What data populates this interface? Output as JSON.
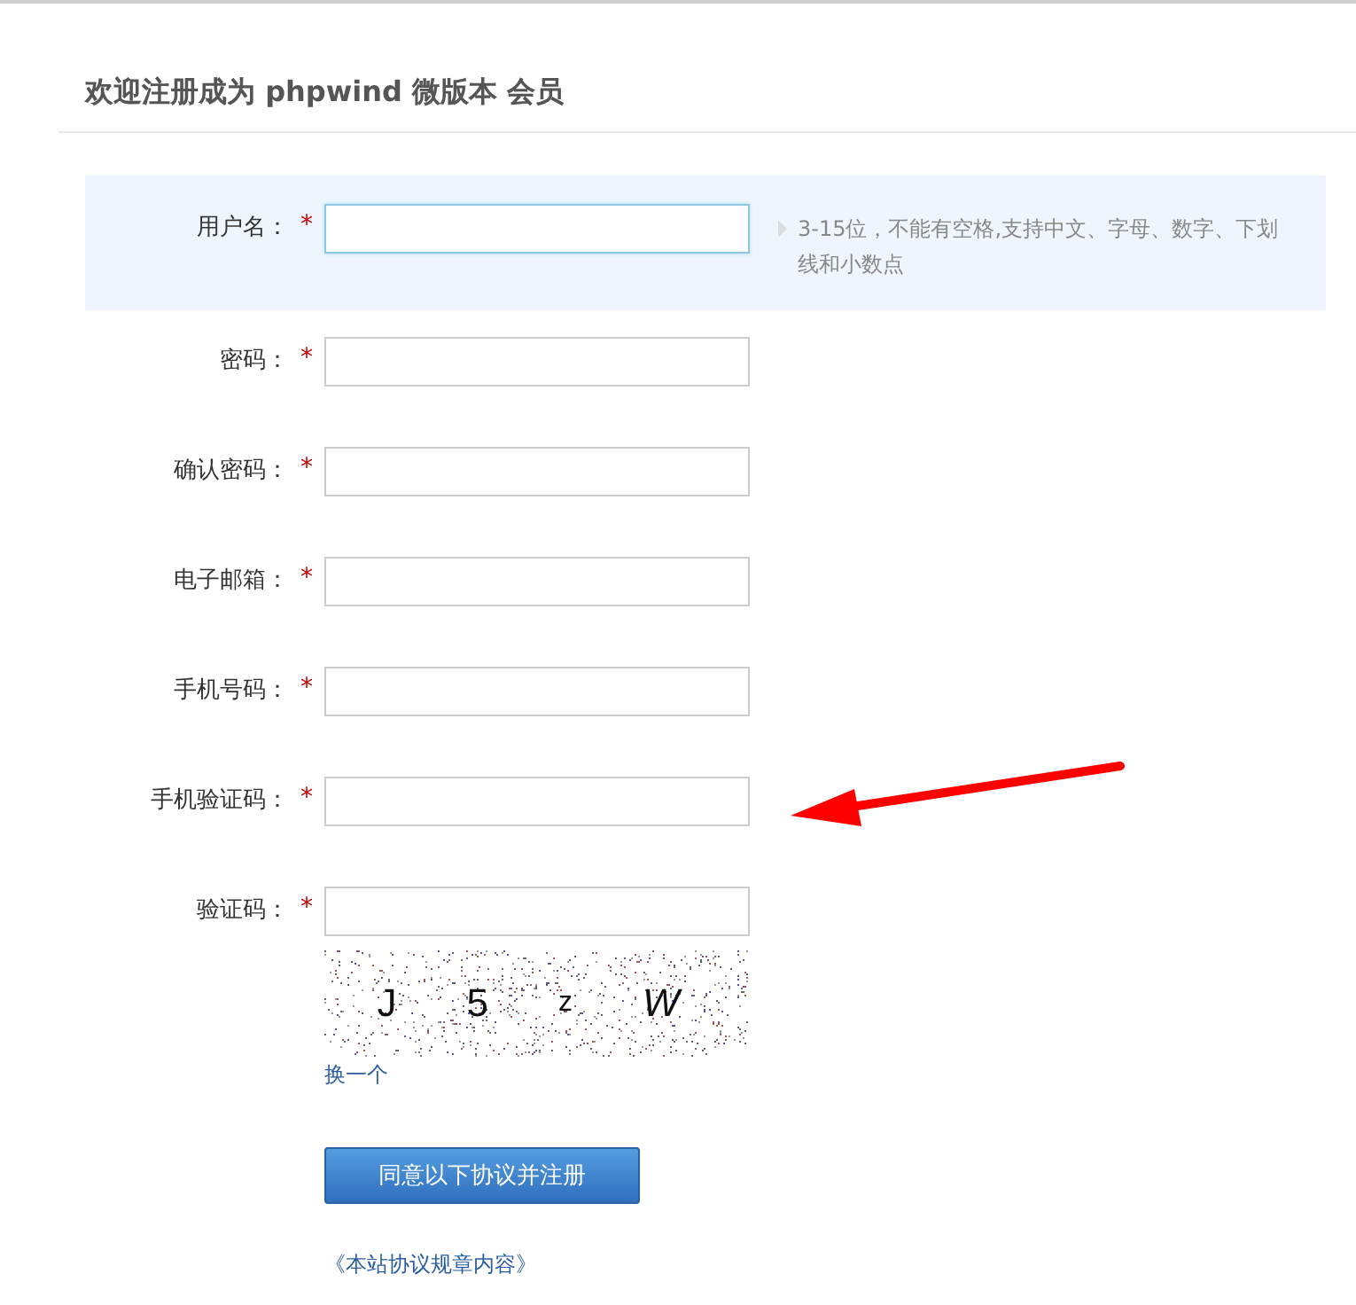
{
  "title": "欢迎注册成为 phpwind 微版本 会员",
  "fields": [
    {
      "label": "用户名：",
      "required": true,
      "focused": true,
      "hint": "3-15位，不能有空格,支持中文、字母、数字、下划线和小数点"
    },
    {
      "label": "密码：",
      "required": true,
      "focused": false
    },
    {
      "label": "确认密码：",
      "required": true,
      "focused": false
    },
    {
      "label": "电子邮箱：",
      "required": true,
      "focused": false
    },
    {
      "label": "手机号码：",
      "required": true,
      "focused": false
    },
    {
      "label": "手机验证码：",
      "required": true,
      "focused": false
    },
    {
      "label": "验证码：",
      "required": true,
      "focused": false
    }
  ],
  "required_mark": "*",
  "captcha": {
    "chars": [
      "J",
      "5",
      "z",
      "W"
    ],
    "refresh": "换一个"
  },
  "submit": "同意以下协议并注册",
  "agreement_link": "《本站协议规章内容》"
}
